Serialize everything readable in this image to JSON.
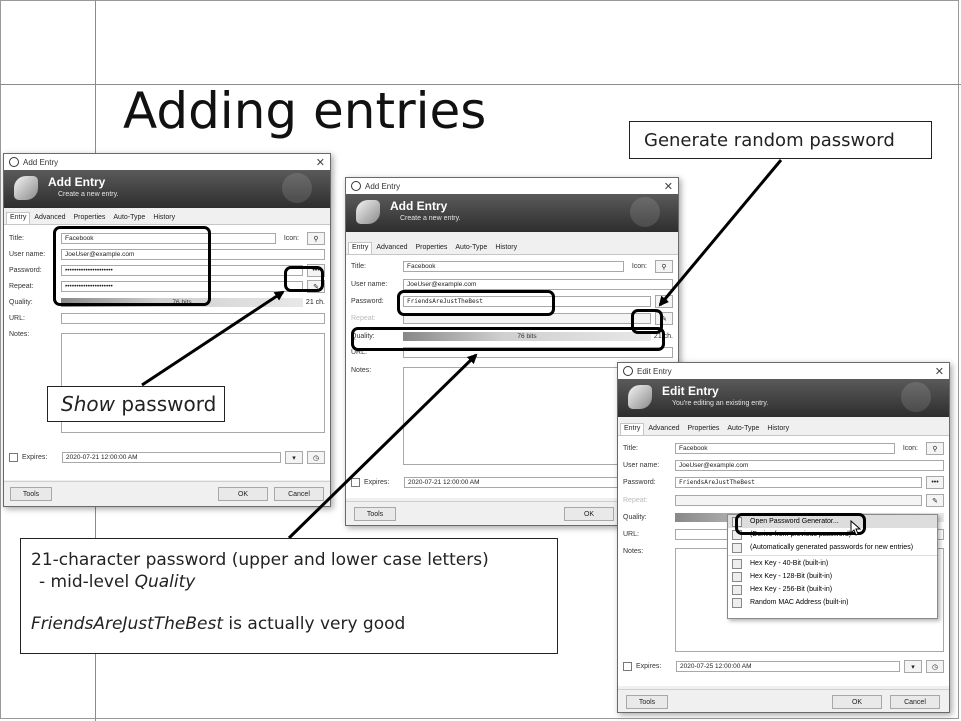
{
  "slide": {
    "title": "Adding entries"
  },
  "callouts": {
    "generate": "Generate random password",
    "show_em": "Show",
    "show_rest": " password",
    "bottom_line1": "21-character password (upper and lower case letters)",
    "bottom_line2_pre": "- mid-level ",
    "bottom_line2_em": "Quality",
    "bottom_line3_em": "FriendsAreJustTheBest",
    "bottom_line3_rest": " is actually very good"
  },
  "dialog1": {
    "window_title": "Add Entry",
    "banner_title": "Add Entry",
    "banner_subtitle": "Create a new entry.",
    "tabs": [
      "Entry",
      "Advanced",
      "Properties",
      "Auto-Type",
      "History"
    ],
    "labels": {
      "title": "Title:",
      "username": "User name:",
      "password": "Password:",
      "repeat": "Repeat:",
      "quality": "Quality:",
      "url": "URL:",
      "notes": "Notes:",
      "icon": "Icon:",
      "expires": "Expires:"
    },
    "title_value": "Facebook",
    "username_value": "JoeUser@example.com",
    "password_value": "•••••••••••••••••••••",
    "repeat_value": "•••••••••••••••••••••",
    "quality_bits": "76 bits",
    "quality_chars": "21 ch.",
    "expires_value": "2020-07-21 12:00:00 AM",
    "show_button": "•••",
    "tools": "Tools",
    "ok": "OK",
    "cancel": "Cancel"
  },
  "dialog2": {
    "window_title": "Add Entry",
    "banner_title": "Add Entry",
    "banner_subtitle": "Create a new entry.",
    "tabs": [
      "Entry",
      "Advanced",
      "Properties",
      "Auto-Type",
      "History"
    ],
    "labels": {
      "title": "Title:",
      "username": "User name:",
      "password": "Password:",
      "repeat": "Repeat:",
      "quality": "Quality:",
      "url": "URL:",
      "notes": "Notes:",
      "icon": "Icon:",
      "expires": "Expires:"
    },
    "title_value": "Facebook",
    "username_value": "JoeUser@example.com",
    "password_value": "FriendsAreJustTheBest",
    "quality_bits": "76 bits",
    "quality_chars": "21 ch.",
    "expires_value": "2020-07-21 12:00:00 AM",
    "show_button": "•••",
    "tools": "Tools",
    "ok": "OK"
  },
  "dialog3": {
    "window_title": "Edit Entry",
    "banner_title": "Edit Entry",
    "banner_subtitle": "You're editing an existing entry.",
    "tabs": [
      "Entry",
      "Advanced",
      "Properties",
      "Auto-Type",
      "History"
    ],
    "labels": {
      "title": "Title:",
      "username": "User name:",
      "password": "Password:",
      "repeat": "Repeat:",
      "quality": "Quality:",
      "url": "URL:",
      "notes": "Notes:",
      "icon": "Icon:",
      "expires": "Expires:"
    },
    "title_value": "Facebook",
    "username_value": "JoeUser@example.com",
    "password_value": "FriendsAreJustTheBest",
    "expires_value": "2020-07-25 12:00:00 AM",
    "show_button": "•••",
    "tools": "Tools",
    "ok": "OK",
    "cancel": "Cancel",
    "menu": [
      "Open Password Generator...",
      "(Derive from previous password)",
      "(Automatically generated passwords for new entries)",
      "Hex Key - 40-Bit (built-in)",
      "Hex Key - 128-Bit (built-in)",
      "Hex Key - 256-Bit (built-in)",
      "Random MAC Address (built-in)"
    ]
  }
}
